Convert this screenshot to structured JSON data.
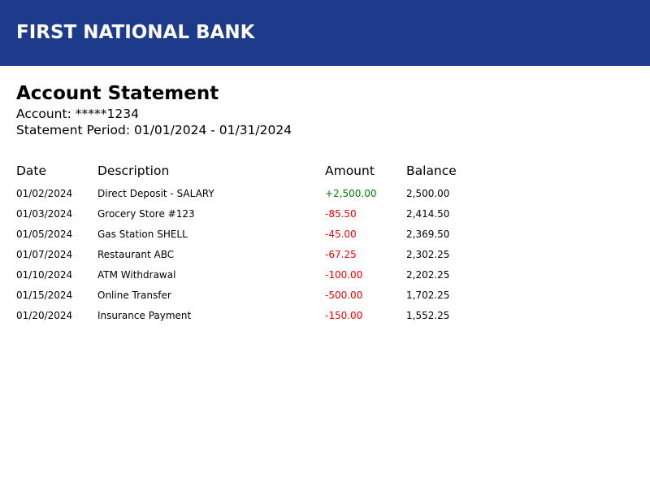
{
  "colors": {
    "header_bg": "#1e3a8a",
    "credit": "#008000",
    "debit": "#ff0000"
  },
  "header": {
    "bank_name": "FIRST NATIONAL BANK"
  },
  "statement": {
    "title": "Account Statement",
    "account_line": "Account: *****1234",
    "period_line": "Statement Period: 01/01/2024 - 01/31/2024"
  },
  "table": {
    "columns": [
      "Date",
      "Description",
      "Amount",
      "Balance"
    ],
    "rows": [
      {
        "date": "01/02/2024",
        "description": "Direct Deposit - SALARY",
        "amount": "+2,500.00",
        "balance": "2,500.00",
        "type": "credit"
      },
      {
        "date": "01/03/2024",
        "description": "Grocery Store #123",
        "amount": "-85.50",
        "balance": "2,414.50",
        "type": "debit"
      },
      {
        "date": "01/05/2024",
        "description": "Gas Station SHELL",
        "amount": "-45.00",
        "balance": "2,369.50",
        "type": "debit"
      },
      {
        "date": "01/07/2024",
        "description": "Restaurant ABC",
        "amount": "-67.25",
        "balance": "2,302.25",
        "type": "debit"
      },
      {
        "date": "01/10/2024",
        "description": "ATM Withdrawal",
        "amount": "-100.00",
        "balance": "2,202.25",
        "type": "debit"
      },
      {
        "date": "01/15/2024",
        "description": "Online Transfer",
        "amount": "-500.00",
        "balance": "1,702.25",
        "type": "debit"
      },
      {
        "date": "01/20/2024",
        "description": "Insurance Payment",
        "amount": "-150.00",
        "balance": "1,552.25",
        "type": "debit"
      }
    ]
  }
}
